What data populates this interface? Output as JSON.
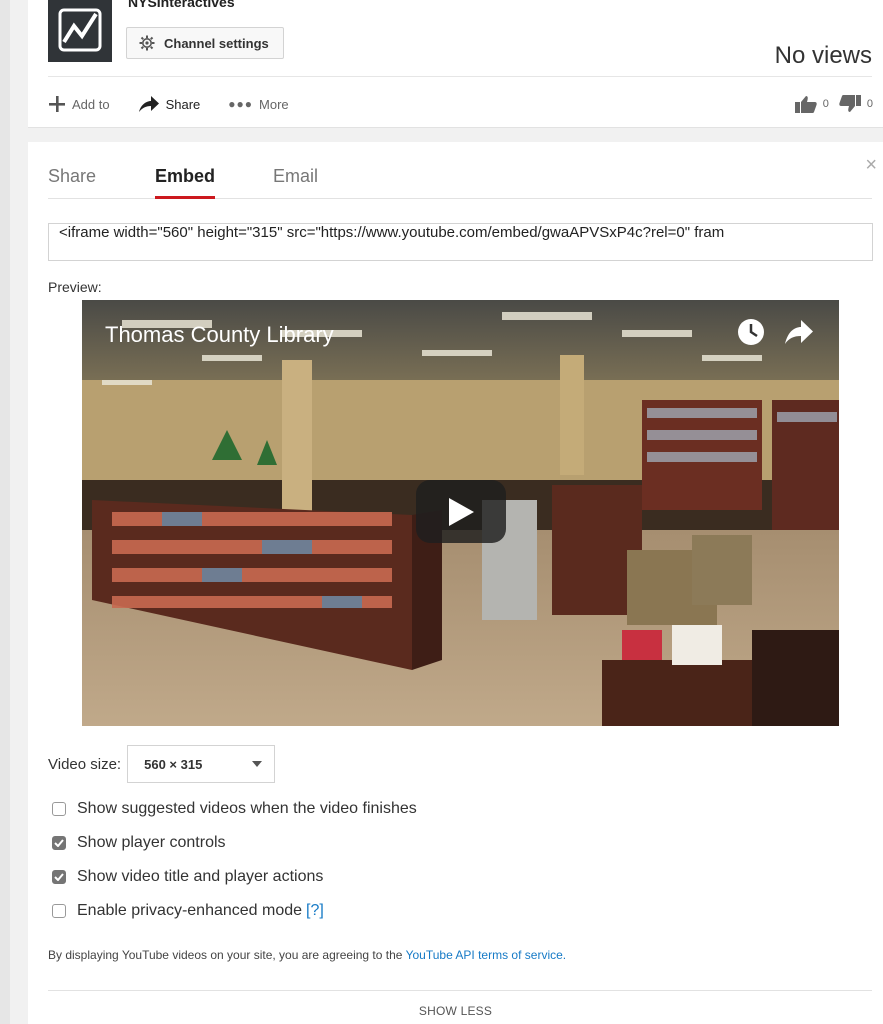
{
  "channel": {
    "name": "NYSInteractives",
    "settings_label": "Channel settings",
    "views": "No views"
  },
  "actions": {
    "add_to": "Add to",
    "share": "Share",
    "more": "More",
    "likes": "0",
    "dislikes": "0"
  },
  "share_panel": {
    "tabs": [
      "Share",
      "Embed",
      "Email"
    ],
    "active_tab": "Embed",
    "close": "×",
    "embed_code": "<iframe width=\"560\" height=\"315\" src=\"https://www.youtube.com/embed/gwaAPVSxP4c?rel=0\" fram",
    "preview_label": "Preview:",
    "video_title": "Thomas County Library",
    "video_size_label": "Video size:",
    "video_size_value": "560 × 315",
    "options": [
      {
        "label": "Show suggested videos when the video finishes",
        "checked": false
      },
      {
        "label": "Show player controls",
        "checked": true
      },
      {
        "label": "Show video title and player actions",
        "checked": true
      },
      {
        "label": "Enable privacy-enhanced mode",
        "checked": false,
        "help": "[?]"
      }
    ],
    "terms_text": "By displaying YouTube videos on your site, you are agreeing to the",
    "terms_link": "YouTube API terms of service.",
    "show_less": "SHOW LESS"
  },
  "colors": {
    "accent_red": "#cc181e",
    "link_blue": "#167ac6",
    "checkbox_checked": "#757575"
  },
  "icons": [
    "gear-icon",
    "plus-icon",
    "share-arrow-icon",
    "more-dots-icon",
    "thumbs-up-icon",
    "thumbs-down-icon",
    "close-icon",
    "clock-icon",
    "play-icon",
    "caret-down-icon"
  ]
}
